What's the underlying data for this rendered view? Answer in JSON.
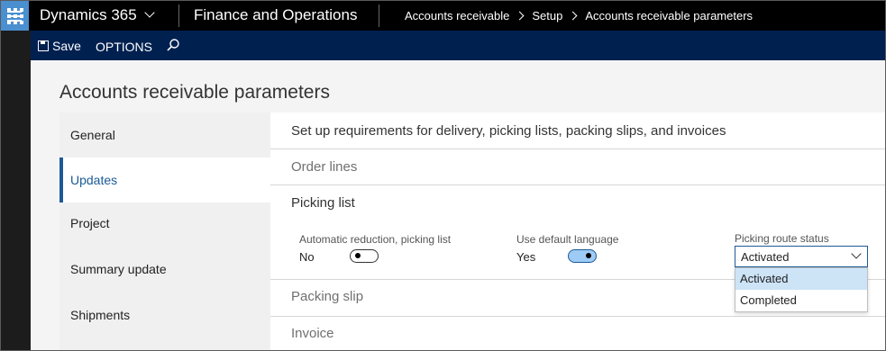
{
  "topbar": {
    "brand": "Dynamics 365",
    "module": "Finance and Operations",
    "breadcrumbs": [
      "Accounts receivable",
      "Setup",
      "Accounts receivable parameters"
    ]
  },
  "actionbar": {
    "save_label": "Save",
    "options_label": "OPTIONS"
  },
  "page": {
    "title": "Accounts receivable parameters"
  },
  "leftnav": {
    "items": [
      {
        "label": "General"
      },
      {
        "label": "Updates"
      },
      {
        "label": "Project"
      },
      {
        "label": "Summary update"
      },
      {
        "label": "Shipments"
      }
    ],
    "active_index": 1
  },
  "content": {
    "header": "Set up requirements for delivery, picking lists, packing slips, and invoices",
    "sections": {
      "order_lines": "Order lines",
      "picking_list": "Picking list",
      "packing_slip": "Packing slip",
      "invoice": "Invoice"
    },
    "fields": {
      "auto_reduction": {
        "label": "Automatic reduction, picking list",
        "value": "No",
        "state": false
      },
      "default_language": {
        "label": "Use default language",
        "value": "Yes",
        "state": true
      },
      "route_status": {
        "label": "Picking route status",
        "value": "Activated",
        "options": [
          "Activated",
          "Completed"
        ]
      }
    }
  },
  "colors": {
    "topbar_bg": "#000000",
    "actionbar_bg": "#002050",
    "accent": "#1b5a97",
    "waffle": "#4a8fcf",
    "toggle_on_fill": "#9ecbf5",
    "selected_option": "#cde4f7"
  },
  "icons": [
    "waffle-icon",
    "chevron-down-icon",
    "hamburger-icon",
    "save-icon",
    "search-icon",
    "caret-down-icon"
  ]
}
